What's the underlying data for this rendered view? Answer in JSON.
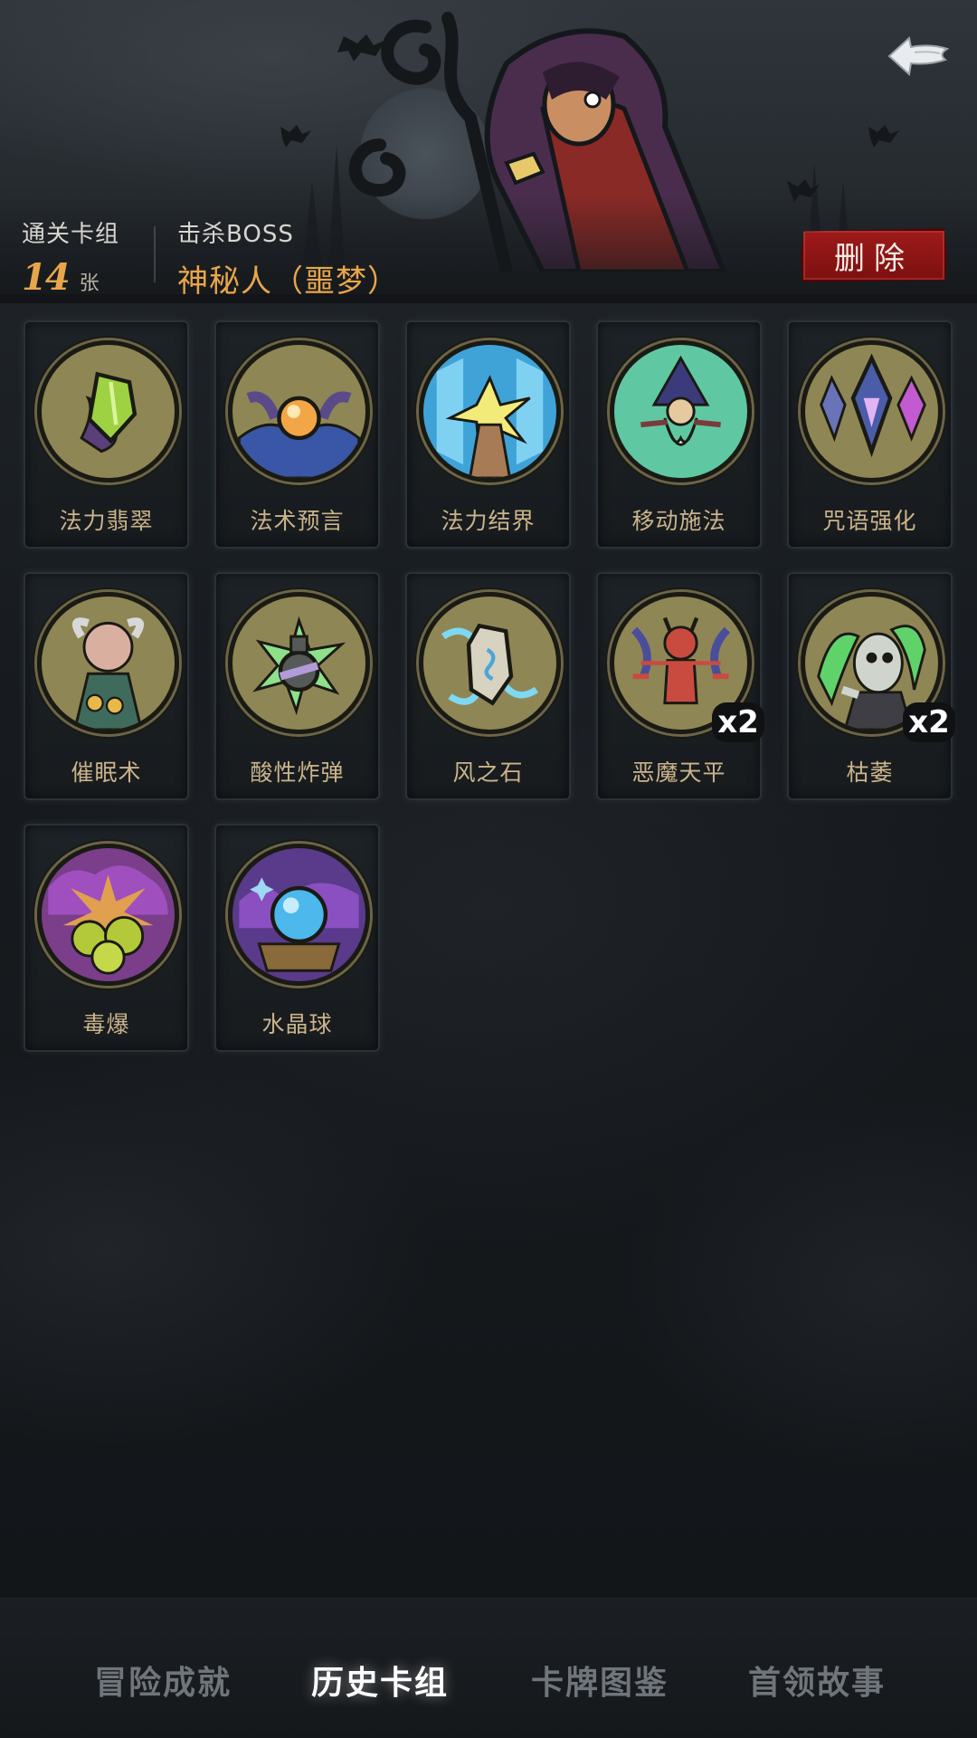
{
  "header": {
    "deck_label": "通关卡组",
    "deck_count": "14",
    "deck_unit": "张",
    "boss_label": "击杀BOSS",
    "boss_name": "神秘人（噩梦）",
    "delete_label": "删除",
    "back_icon": "back-arrow-icon"
  },
  "cards": [
    {
      "name": "法力翡翠",
      "icon": "green-gem-icon"
    },
    {
      "name": "法术预言",
      "icon": "crystal-orb-hands-icon"
    },
    {
      "name": "法力结界",
      "icon": "barrier-hand-icon"
    },
    {
      "name": "移动施法",
      "icon": "wizard-casting-icon"
    },
    {
      "name": "咒语强化",
      "icon": "crystal-shards-icon"
    },
    {
      "name": "催眠术",
      "icon": "hypnotist-icon"
    },
    {
      "name": "酸性炸弹",
      "icon": "acid-bomb-icon"
    },
    {
      "name": "风之石",
      "icon": "wind-stone-icon"
    },
    {
      "name": "恶魔天平",
      "icon": "demon-scale-icon",
      "count": "x2"
    },
    {
      "name": "枯萎",
      "icon": "wither-zombie-icon",
      "count": "x2"
    },
    {
      "name": "毒爆",
      "icon": "poison-burst-icon"
    },
    {
      "name": "水晶球",
      "icon": "crystal-ball-icon"
    }
  ],
  "tabs": [
    {
      "label": "冒险成就",
      "active": false
    },
    {
      "label": "历史卡组",
      "active": true
    },
    {
      "label": "卡牌图鉴",
      "active": false
    },
    {
      "label": "首领故事",
      "active": false
    }
  ],
  "colors": {
    "accent_orange": "#e7a64a",
    "card_name": "#cbb48b",
    "delete_red": "#8e1414",
    "icon_base": "#8f8655"
  }
}
